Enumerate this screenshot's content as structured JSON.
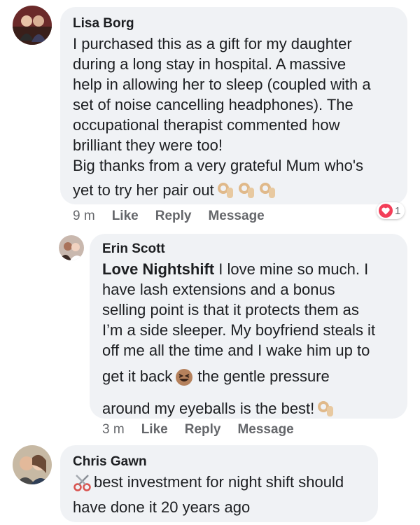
{
  "comments": [
    {
      "author": "Lisa Borg",
      "lines": [
        "I purchased this as a gift for my daughter",
        "during a long stay in hospital. A massive",
        "help in allowing her to sleep (coupled with a",
        "set of noise cancelling headphones). The",
        "occupational therapist commented how",
        "brilliant they were too!",
        "Big thanks from a very grateful Mum who's",
        "yet to try her pair out"
      ],
      "time": "9 m",
      "like": "Like",
      "reply": "Reply",
      "message": "Message",
      "reaction_count": "1"
    },
    {
      "author": "Erin Scott",
      "tag": "Love Nightshift",
      "lines": [
        " I love mine so much. I",
        "have lash extensions and a bonus",
        "selling point is that it protects them as",
        "I’m a side sleeper. My boyfriend steals it",
        "off me all the time and I wake him up to",
        "get it back",
        " the gentle pressure",
        "around my eyeballs is the best!"
      ],
      "time": "3 m",
      "like": "Like",
      "reply": "Reply",
      "message": "Message"
    },
    {
      "author": "Chris Gawn",
      "lines": [
        "best investment for night shift should",
        "have done it 20 years ago"
      ]
    }
  ],
  "icons": {
    "ok_hand": "ok-hand-emoji",
    "grin": "grinning-squinting-emoji",
    "scissors": "scissors-emoji",
    "heart": "heart-reaction"
  },
  "colors": {
    "bubble": "#f0f2f5",
    "meta": "#65676b",
    "heart": "#f33e58"
  }
}
